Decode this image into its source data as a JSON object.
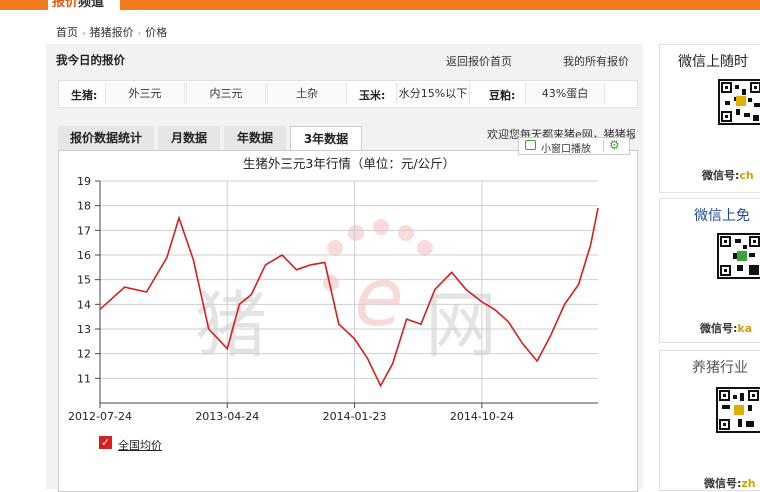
{
  "header": {
    "logo_part1": "报价",
    "logo_part2": "频道"
  },
  "breadcrumb": [
    "首页",
    "猪猪报价",
    "价格"
  ],
  "panel": {
    "title": "我今日的报价",
    "link_return": "返回报价首页",
    "link_mine": "我的所有报价"
  },
  "filters": {
    "pig_label": "生猪:",
    "pig_options": [
      "外三元",
      "内三元",
      "土杂"
    ],
    "corn_label": "玉米:",
    "corn_option": "水分15%以下",
    "soy_label": "豆粕:",
    "soy_option": "43%蛋白"
  },
  "tabs": [
    "报价数据统计",
    "月数据",
    "年数据",
    "3年数据"
  ],
  "active_tab_index": 3,
  "welcome_text": "欢迎您每天都来猪e网，猪猪报价",
  "mini_player": {
    "label": "小窗口播放",
    "icons": [
      "tv-icon",
      "gear-icon"
    ]
  },
  "watermark": {
    "left": "猪",
    "right": "网",
    "logo": "e"
  },
  "chart_data": {
    "type": "line",
    "title": "生猪外三元3年行情（单位：元/公斤）",
    "x": [
      "2012-07-24",
      "2012-09-15",
      "2012-11-01",
      "2012-12-15",
      "2013-01-10",
      "2013-02-10",
      "2013-03-15",
      "2013-04-24",
      "2013-05-20",
      "2013-06-15",
      "2013-07-15",
      "2013-08-20",
      "2013-09-20",
      "2013-10-20",
      "2013-11-20",
      "2013-12-20",
      "2014-01-23",
      "2014-02-20",
      "2014-03-20",
      "2014-04-15",
      "2014-05-15",
      "2014-06-15",
      "2014-07-15",
      "2014-08-20",
      "2014-09-20",
      "2014-10-24",
      "2014-11-20",
      "2014-12-20",
      "2015-01-20",
      "2015-02-20",
      "2015-03-20",
      "2015-04-20",
      "2015-05-20",
      "2015-06-15",
      "2015-07-01"
    ],
    "x_ticks": [
      "2012-07-24",
      "2013-04-24",
      "2014-01-23",
      "2014-10-24"
    ],
    "series": [
      {
        "values": [
          13.8,
          14.7,
          14.5,
          15.9,
          17.5,
          15.8,
          13.0,
          12.2,
          14.0,
          14.4,
          15.6,
          16.0,
          15.4,
          15.6,
          15.7,
          13.2,
          12.6,
          11.8,
          10.7,
          11.6,
          13.4,
          13.2,
          14.6,
          15.3,
          14.6,
          14.1,
          13.8,
          13.3,
          12.4,
          11.7,
          12.7,
          14.0,
          14.8,
          16.4,
          17.9
        ]
      }
    ],
    "ylim": [
      10,
      19
    ],
    "y_ticks": [
      11,
      12,
      13,
      14,
      15,
      16,
      17,
      18,
      19
    ],
    "legend": {
      "label": "全国均价",
      "checked": true
    },
    "color": "#d61f1f"
  },
  "sidebar": [
    {
      "title": "微信上随时",
      "wechat_label": "微信号:",
      "wechat_id": "ch"
    },
    {
      "title": "微信上免",
      "wechat_label": "微信号:",
      "wechat_id": "ka"
    },
    {
      "title": "养猪行业",
      "wechat_label": "微信号:",
      "wechat_id": "zh"
    }
  ]
}
